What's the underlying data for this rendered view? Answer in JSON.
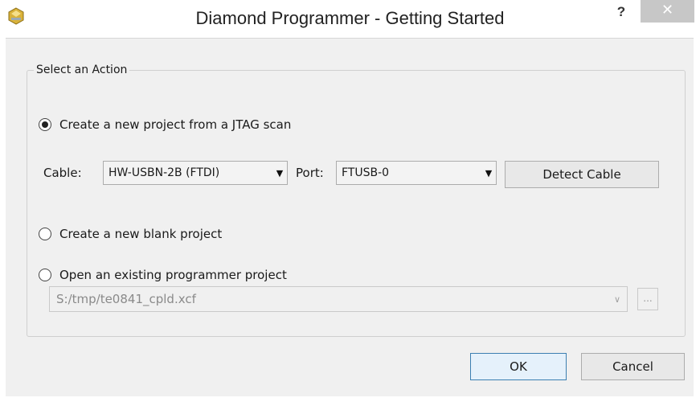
{
  "window": {
    "title": "Diamond Programmer - Getting Started",
    "help_label": "?",
    "close_label": "✕"
  },
  "group": {
    "legend": "Select an Action"
  },
  "options": {
    "jtag_scan": {
      "label": "Create a new project from a JTAG scan",
      "selected": true
    },
    "blank_project": {
      "label": "Create a new blank project",
      "selected": false
    },
    "open_existing": {
      "label": "Open an existing programmer project",
      "selected": false
    }
  },
  "cable": {
    "label": "Cable:",
    "value": "HW-USBN-2B (FTDI)"
  },
  "port": {
    "label": "Port:",
    "value": "FTUSB-0"
  },
  "detect_cable_label": "Detect Cable",
  "existing_project": {
    "path": "S:/tmp/te0841_cpld.xcf",
    "browse_label": "..."
  },
  "footer": {
    "ok_label": "OK",
    "cancel_label": "Cancel"
  },
  "icons": {
    "app": "diamond-programmer-app-icon",
    "dropdown": "chevron-down-icon"
  }
}
